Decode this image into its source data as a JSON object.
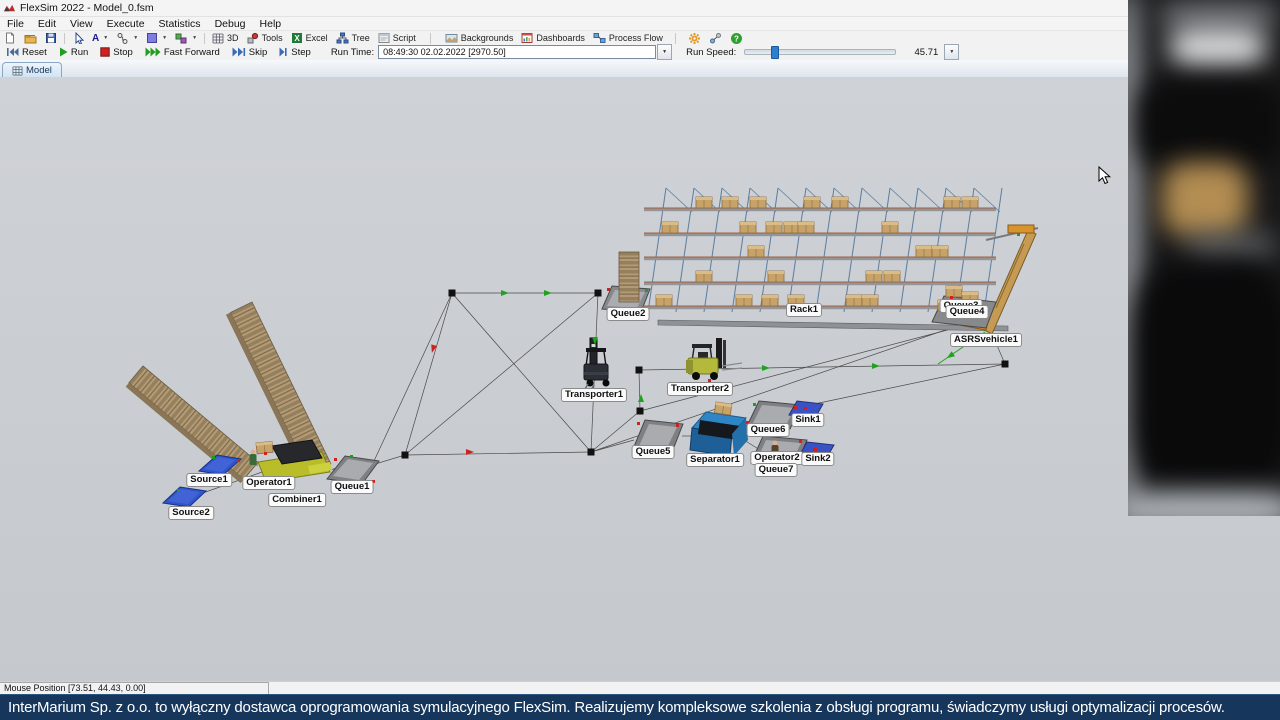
{
  "window": {
    "title": "FlexSim 2022 - Model_0.fsm"
  },
  "menu": {
    "items": [
      "File",
      "Edit",
      "View",
      "Execute",
      "Statistics",
      "Debug",
      "Help"
    ]
  },
  "toolbar": {
    "view_3d": "3D",
    "tools": "Tools",
    "excel": "Excel",
    "tree": "Tree",
    "script": "Script",
    "backgrounds": "Backgrounds",
    "dashboards": "Dashboards",
    "process_flow": "Process Flow",
    "icon_names": [
      "new-model-icon",
      "open-icon",
      "save-icon",
      "select-cursor-icon",
      "text-tool-icon",
      "connections-tool-icon",
      "fill-tool-icon",
      "objects-tool-icon",
      "grid-3d-icon",
      "tools-icon",
      "excel-icon",
      "tree-icon",
      "script-icon",
      "backgrounds-icon",
      "dashboards-icon",
      "process-flow-icon",
      "settings-gear-icon",
      "connector-icon",
      "help-icon"
    ]
  },
  "run_controls": {
    "reset": "Reset",
    "run": "Run",
    "stop": "Stop",
    "fast_forward": "Fast Forward",
    "skip": "Skip",
    "step": "Step",
    "run_time_label": "Run Time:",
    "run_time_value": "08:49:30  02.02.2022  [2970.50]",
    "run_speed_label": "Run Speed:",
    "run_speed_value": "45.71"
  },
  "tabs": {
    "model": "Model"
  },
  "objects": {
    "source1": "Source1",
    "source2": "Source2",
    "operator1": "Operator1",
    "combiner1": "Combiner1",
    "queue1": "Queue1",
    "queue2": "Queue2",
    "transporter1": "Transporter1",
    "transporter2": "Transporter2",
    "rack1": "Rack1",
    "queue3": "Queue3",
    "queue4": "Queue4",
    "asrsvehicle1": "ASRSvehicle1",
    "queue5": "Queue5",
    "separator1": "Separator1",
    "queue6": "Queue6",
    "queue7": "Queue7",
    "operator2": "Operator2",
    "sink1": "Sink1",
    "sink2": "Sink2"
  },
  "status_bar": {
    "mouse_position": "Mouse Position [73.51, 44.43, 0.00]"
  },
  "banner": {
    "text": "InterMarium Sp. z o.o. to wyłączny dostawca oprogramowania symulacyjnego FlexSim. Realizujemy kompleksowe szkolenia z obsługi programu, świadczymy usługi optymalizacji procesów."
  },
  "glyphs": {
    "dropdown": "▼",
    "question": "?",
    "excel_x": "X",
    "a_tool": "A"
  },
  "colors": {
    "banner_bg": "#16365c",
    "canvas_bg": "#c9cdd1",
    "run_handle": "#2f7fd0",
    "line": "#4a4a4a"
  }
}
